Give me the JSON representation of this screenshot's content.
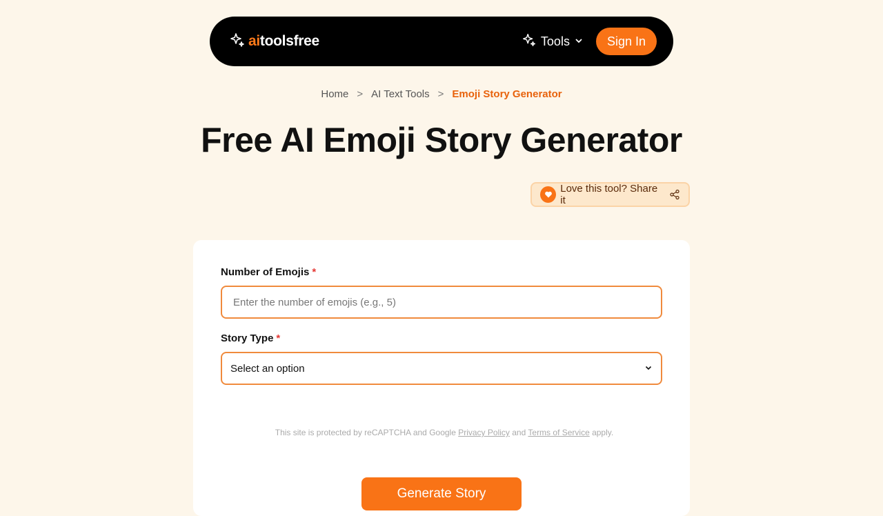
{
  "header": {
    "logo_ai": "ai",
    "logo_rest": "toolsfree",
    "tools_label": "Tools",
    "signin_label": "Sign In"
  },
  "breadcrumb": {
    "items": [
      "Home",
      "AI Text Tools",
      "Emoji Story Generator"
    ],
    "separator": ">"
  },
  "page": {
    "title": "Free AI Emoji Story Generator"
  },
  "share": {
    "label": "Love this tool? Share it"
  },
  "form": {
    "emojis": {
      "label": "Number of Emojis",
      "required_mark": "*",
      "placeholder": "Enter the number of emojis (e.g., 5)",
      "value": ""
    },
    "story_type": {
      "label": "Story Type",
      "required_mark": "*",
      "selected": "Select an option"
    },
    "recaptcha": {
      "prefix": "This site is protected by reCAPTCHA and Google ",
      "privacy": "Privacy Policy",
      "and": " and ",
      "terms": "Terms of Service",
      "suffix": " apply."
    },
    "submit_label": "Generate Story"
  },
  "colors": {
    "accent": "#f97316",
    "background": "#fdf6ea",
    "navbar": "#000000",
    "input_border": "#f08a3c",
    "breadcrumb_current": "#e8620c",
    "required": "#e53935"
  },
  "icons": {
    "logo": "sparkles-icon",
    "tools": "sparkles-icon",
    "tools_chevron": "chevron-down-icon",
    "share_heart": "heart-icon",
    "share": "share-icon",
    "select_chevron": "chevron-down-icon"
  }
}
